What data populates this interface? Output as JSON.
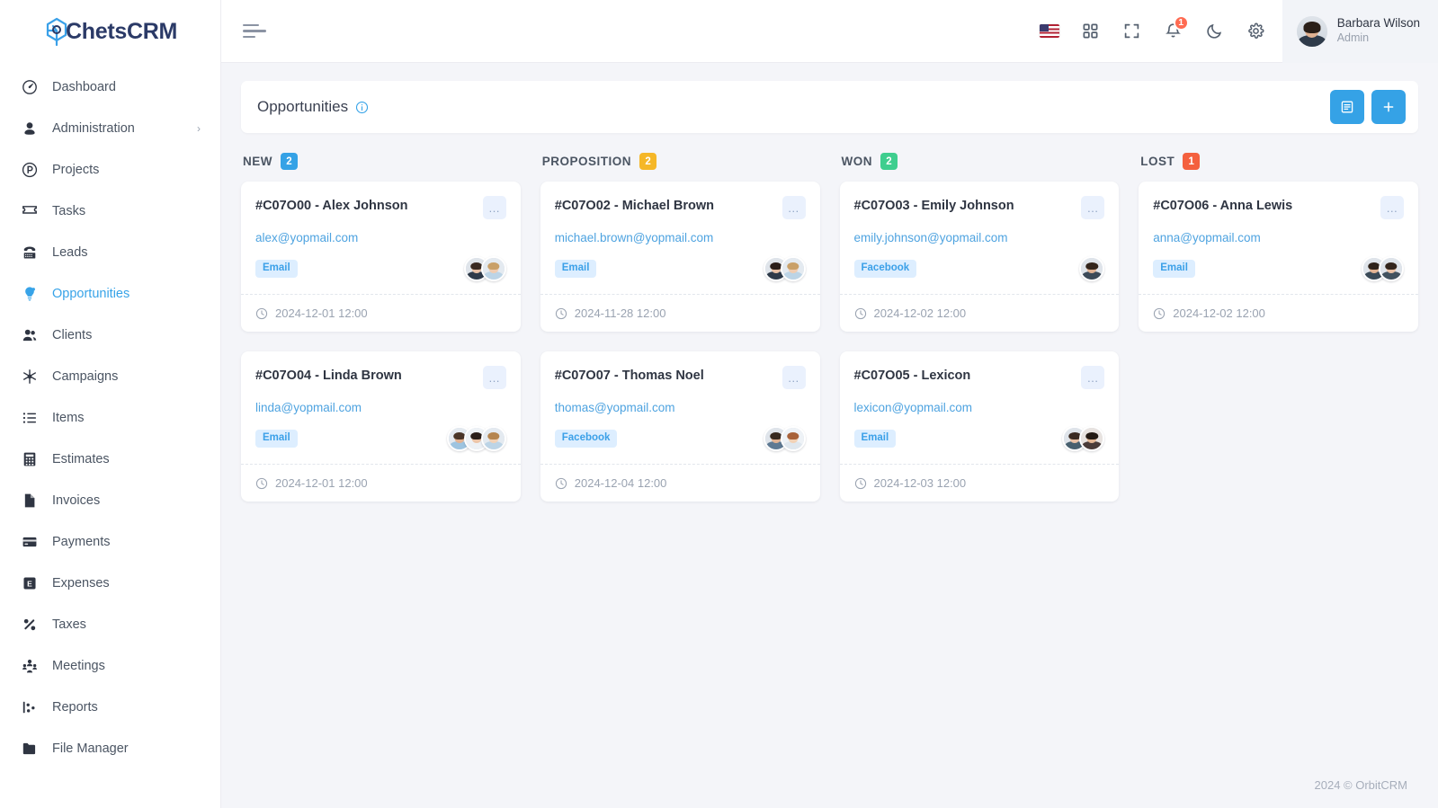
{
  "brand": {
    "name_part1": "C",
    "name_rest": "hetsCRM",
    "full": "ChetsCRM"
  },
  "sidebar": {
    "items": [
      {
        "label": "Dashboard",
        "icon": "speedometer-icon",
        "active": false,
        "caret": false
      },
      {
        "label": "Administration",
        "icon": "user-circle-icon",
        "active": false,
        "caret": true
      },
      {
        "label": "Projects",
        "icon": "project-circle-icon",
        "active": false,
        "caret": false
      },
      {
        "label": "Tasks",
        "icon": "ticket-icon",
        "active": false,
        "caret": false
      },
      {
        "label": "Leads",
        "icon": "telephone-icon",
        "active": false,
        "caret": false
      },
      {
        "label": "Opportunities",
        "icon": "lightbulb-icon",
        "active": true,
        "caret": false
      },
      {
        "label": "Clients",
        "icon": "people-icon",
        "active": false,
        "caret": false
      },
      {
        "label": "Campaigns",
        "icon": "megaphone-star-icon",
        "active": false,
        "caret": false
      },
      {
        "label": "Items",
        "icon": "list-icon",
        "active": false,
        "caret": false
      },
      {
        "label": "Estimates",
        "icon": "calculator-icon",
        "active": false,
        "caret": false
      },
      {
        "label": "Invoices",
        "icon": "file-icon",
        "active": false,
        "caret": false
      },
      {
        "label": "Payments",
        "icon": "credit-card-icon",
        "active": false,
        "caret": false
      },
      {
        "label": "Expenses",
        "icon": "expense-box-icon",
        "active": false,
        "caret": false
      },
      {
        "label": "Taxes",
        "icon": "percent-icon",
        "active": false,
        "caret": false
      },
      {
        "label": "Meetings",
        "icon": "meeting-people-icon",
        "active": false,
        "caret": false
      },
      {
        "label": "Reports",
        "icon": "report-chart-icon",
        "active": false,
        "caret": false
      },
      {
        "label": "File Manager",
        "icon": "folder-icon",
        "active": false,
        "caret": false
      }
    ]
  },
  "topbar": {
    "menu_toggle": "hamburger-icon",
    "icons": [
      {
        "name": "language-flag-us-icon"
      },
      {
        "name": "apps-grid-icon"
      },
      {
        "name": "fullscreen-icon"
      },
      {
        "name": "bell-icon",
        "badge": "1"
      },
      {
        "name": "dark-mode-moon-icon"
      },
      {
        "name": "settings-gear-icon"
      }
    ],
    "profile": {
      "name": "Barbara Wilson",
      "role": "Admin"
    }
  },
  "page": {
    "title": "Opportunities",
    "info_icon": "info-circle-icon",
    "actions": [
      {
        "name": "list-view-button",
        "icon": "list-view-icon"
      },
      {
        "name": "add-opportunity-button",
        "icon": "plus-icon",
        "label": "+"
      }
    ]
  },
  "colors": {
    "accent": "#35a2e6",
    "new_badge": "#35a2e6",
    "proposition_badge": "#f5b728",
    "won_badge": "#3fce8f",
    "lost_badge": "#f4603e",
    "link": "#4ea3e0",
    "notification": "#ff6b52"
  },
  "board": {
    "columns": [
      {
        "title": "NEW",
        "count": "2",
        "badge_color": "#35a2e6",
        "cards": [
          {
            "title": "#C07O00 - Alex Johnson",
            "email": "alex@yopmail.com",
            "source": "Email",
            "date": "2024-12-01 12:00",
            "menu": "…",
            "avatars": [
              {
                "skin": "#e8c1a6",
                "hair": "#3a2a22",
                "cloth": "#2f3b4a"
              },
              {
                "skin": "#f0cdb2",
                "hair": "#c9a068",
                "cloth": "#bcd4e6"
              }
            ]
          },
          {
            "title": "#C07O04 - Linda Brown",
            "email": "linda@yopmail.com",
            "source": "Email",
            "date": "2024-12-01 12:00",
            "menu": "…",
            "avatars": [
              {
                "skin": "#e2b393",
                "hair": "#4a3528",
                "cloth": "#9dc4e0"
              },
              {
                "skin": "#ecc5a8",
                "hair": "#2b1f1a",
                "cloth": "#edf1f5"
              },
              {
                "skin": "#f2d2b6",
                "hair": "#b5854f",
                "cloth": "#bcd4e6"
              }
            ]
          }
        ]
      },
      {
        "title": "PROPOSITION",
        "count": "2",
        "badge_color": "#f5b728",
        "cards": [
          {
            "title": "#C07O02 - Michael Brown",
            "email": "michael.brown@yopmail.com",
            "source": "Email",
            "date": "2024-11-28 12:00",
            "menu": "…",
            "avatars": [
              {
                "skin": "#e8c1a6",
                "hair": "#2b1f1a",
                "cloth": "#2f3b4a"
              },
              {
                "skin": "#f0cdb2",
                "hair": "#c9a068",
                "cloth": "#bcd4e6"
              }
            ]
          },
          {
            "title": "#C07O07 - Thomas Noel",
            "email": "thomas@yopmail.com",
            "source": "Facebook",
            "date": "2024-12-04 12:00",
            "menu": "…",
            "avatars": [
              {
                "skin": "#e2b393",
                "hair": "#37291f",
                "cloth": "#5f7a93"
              },
              {
                "skin": "#f2d2b6",
                "hair": "#a8623a",
                "cloth": "#dfe7ee"
              }
            ]
          }
        ]
      },
      {
        "title": "WON",
        "count": "2",
        "badge_color": "#3fce8f",
        "cards": [
          {
            "title": "#C07O03 - Emily Johnson",
            "email": "emily.johnson@yopmail.com",
            "source": "Facebook",
            "date": "2024-12-02 12:00",
            "menu": "…",
            "avatars": [
              {
                "skin": "#dfb293",
                "hair": "#33251c",
                "cloth": "#3c4a58"
              }
            ]
          },
          {
            "title": "#C07O05 - Lexicon",
            "email": "lexicon@yopmail.com",
            "source": "Email",
            "date": "2024-12-03 12:00",
            "menu": "…",
            "avatars": [
              {
                "skin": "#e8c1a6",
                "hair": "#3a2a22",
                "cloth": "#48606f"
              },
              {
                "skin": "#e3b795",
                "hair": "#241a14",
                "cloth": "#4a3c39"
              }
            ]
          }
        ]
      },
      {
        "title": "LOST",
        "count": "1",
        "badge_color": "#f4603e",
        "cards": [
          {
            "title": "#C07O06 - Anna Lewis",
            "email": "anna@yopmail.com",
            "source": "Email",
            "date": "2024-12-02 12:00",
            "menu": "…",
            "avatars": [
              {
                "skin": "#e2b393",
                "hair": "#2e221a",
                "cloth": "#3a4a57"
              },
              {
                "skin": "#e8c1a6",
                "hair": "#33251c",
                "cloth": "#41525f"
              }
            ]
          }
        ]
      }
    ]
  },
  "footer": {
    "text": "2024 © OrbitCRM"
  }
}
